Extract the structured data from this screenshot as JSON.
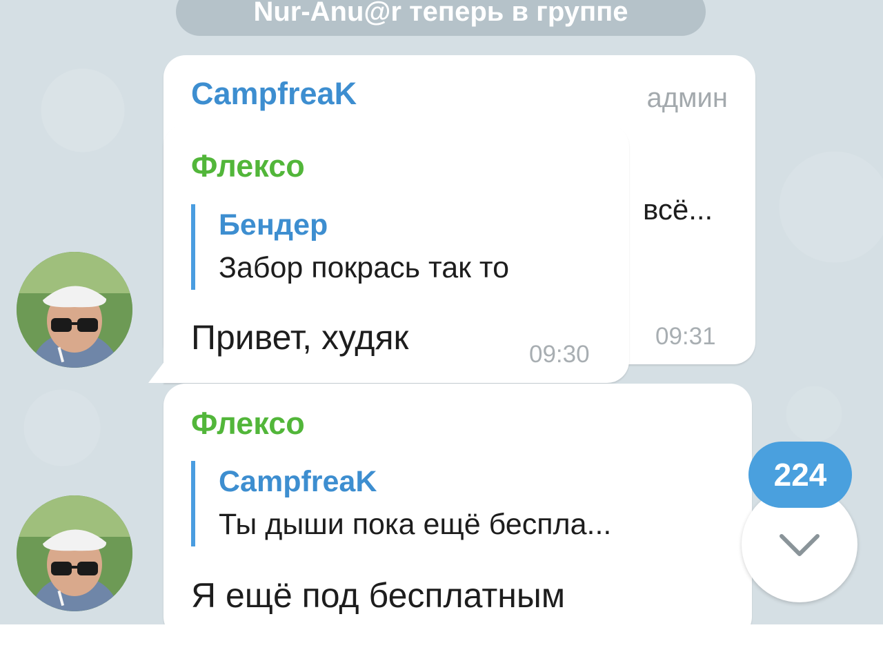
{
  "service_message": "Nur-Anu@r теперь в группе",
  "messages": {
    "back": {
      "sender": "CampfreaK",
      "role": "админ",
      "text_fragment": "всё...",
      "time": "09:31"
    },
    "front": {
      "sender": "Флексо",
      "reply_to": {
        "name": "Бендер",
        "text": "Забор покрась так то"
      },
      "text": "Привет, худяк",
      "time": "09:30"
    },
    "third": {
      "sender": "Флексо",
      "reply_to": {
        "name": "CampfreaK",
        "text": "Ты дыши пока ещё беспла..."
      },
      "text": "Я ещё под бесплатным"
    }
  },
  "unread_counter": "224",
  "icons": {
    "scroll_down": "chevron-down-icon",
    "avatar": "user-avatar"
  },
  "colors": {
    "accent_blue": "#3d8ed0",
    "sender_green": "#52b63a",
    "counter_bg": "#4aa0de",
    "wallpaper": "#d5dfe4"
  }
}
